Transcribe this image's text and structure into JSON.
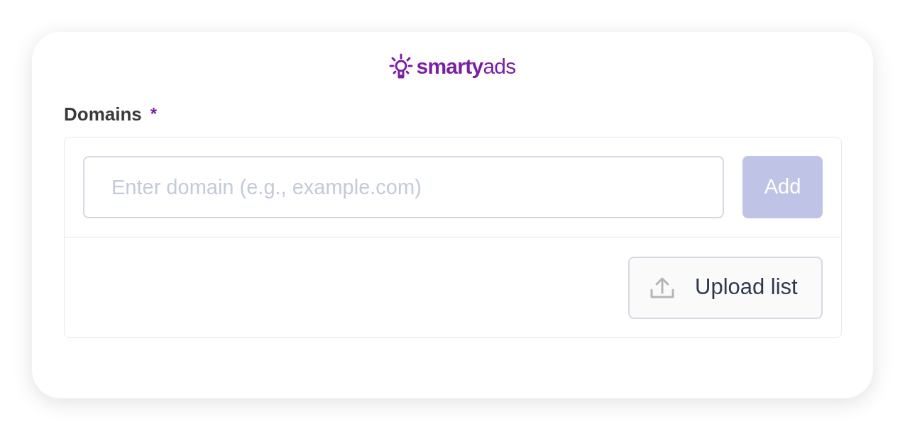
{
  "logo": {
    "bold": "smarty",
    "light": "ads"
  },
  "field": {
    "label": "Domains",
    "required_mark": "*",
    "placeholder": "Enter domain (e.g., example.com)"
  },
  "add_button": {
    "label": "Add",
    "disabled": true
  },
  "upload_button": {
    "label": "Upload list"
  }
}
